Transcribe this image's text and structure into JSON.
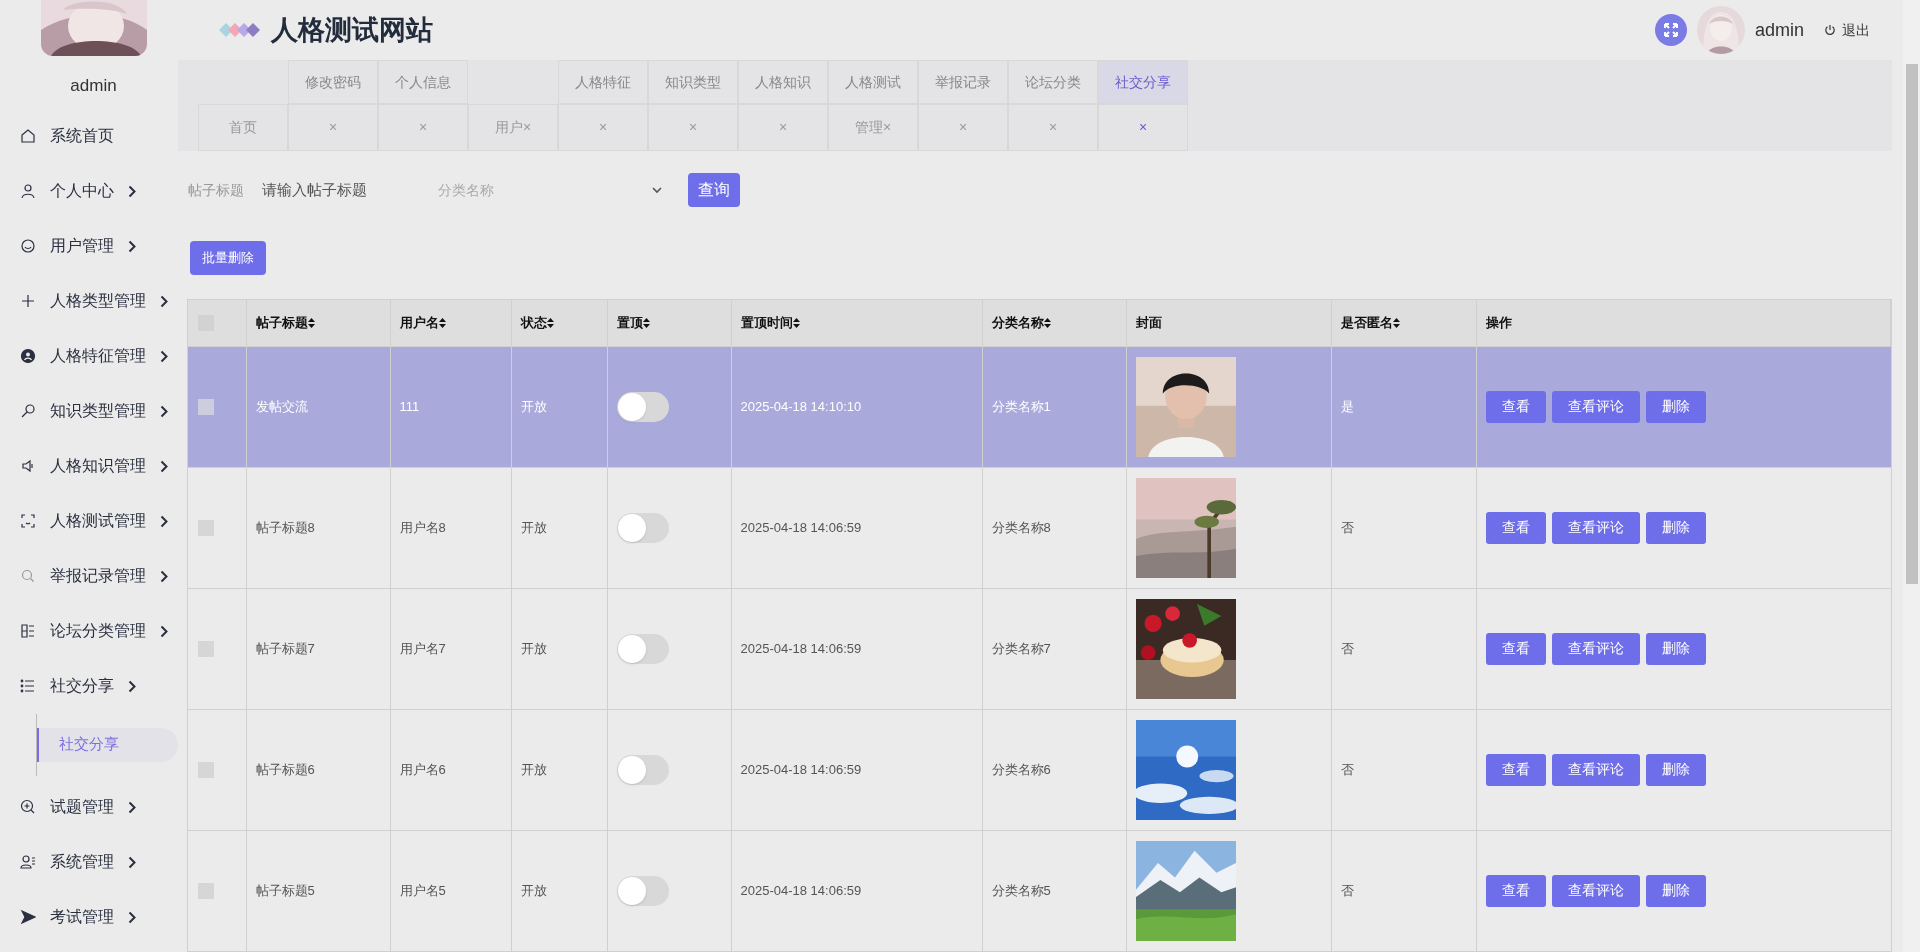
{
  "site_title": "人格测试网站",
  "sidebar": {
    "user": "admin",
    "menu": [
      {
        "label": "系统首页",
        "has_arrow": false
      },
      {
        "label": "个人中心",
        "has_arrow": true
      },
      {
        "label": "用户管理",
        "has_arrow": true
      },
      {
        "label": "人格类型管理",
        "has_arrow": true
      },
      {
        "label": "人格特征管理",
        "has_arrow": true
      },
      {
        "label": "知识类型管理",
        "has_arrow": true
      },
      {
        "label": "人格知识管理",
        "has_arrow": true
      },
      {
        "label": "人格测试管理",
        "has_arrow": true
      },
      {
        "label": "举报记录管理",
        "has_arrow": true
      },
      {
        "label": "论坛分类管理",
        "has_arrow": true
      },
      {
        "label": "社交分享",
        "has_arrow": true,
        "children": [
          {
            "label": "社交分享",
            "selected": true
          }
        ]
      },
      {
        "label": "试题管理",
        "has_arrow": true
      },
      {
        "label": "系统管理",
        "has_arrow": true
      },
      {
        "label": "考试管理",
        "has_arrow": true
      }
    ]
  },
  "header": {
    "user": "admin",
    "logout": "退出"
  },
  "tabs": [
    {
      "bottom": "首页",
      "selected": false
    },
    {
      "top": "修改密码",
      "bottom": "×",
      "selected": false
    },
    {
      "top": "个人信息",
      "bottom": "×",
      "selected": false
    },
    {
      "bottom": "用户×",
      "selected": false
    },
    {
      "top": "人格特征",
      "bottom": "×",
      "selected": false
    },
    {
      "top": "知识类型",
      "bottom": "×",
      "selected": false
    },
    {
      "top": "人格知识",
      "bottom": "×",
      "selected": false
    },
    {
      "top": "人格测试",
      "bottom": "管理×",
      "selected": false
    },
    {
      "top": "举报记录",
      "bottom": "×",
      "selected": false
    },
    {
      "top": "论坛分类",
      "bottom": "×",
      "selected": false
    },
    {
      "top": "社交分享",
      "bottom": "×",
      "selected": true
    }
  ],
  "search": {
    "label": "帖子标题",
    "placeholder": "请输入帖子标题",
    "category_placeholder": "分类名称",
    "button": "查询"
  },
  "batch_delete": "批量删除",
  "table": {
    "header_checked": false,
    "columns": [
      {
        "label": "帖子标题",
        "sortable": true
      },
      {
        "label": "用户名",
        "sortable": true
      },
      {
        "label": "状态",
        "sortable": true
      },
      {
        "label": "置顶",
        "sortable": true
      },
      {
        "label": "置顶时间",
        "sortable": true
      },
      {
        "label": "分类名称",
        "sortable": true
      },
      {
        "label": "封面",
        "sortable": false
      },
      {
        "label": "是否匿名",
        "sortable": true
      },
      {
        "label": "操作",
        "sortable": false
      }
    ],
    "rows": [
      {
        "selected": true,
        "checked": false,
        "title": "发帖交流",
        "user": "111",
        "status": "开放",
        "pinned": false,
        "pin_time": "2025-04-18 14:10:10",
        "category": "分类名称1",
        "anonymous": "是",
        "actions": [
          "查看",
          "查看评论",
          "删除"
        ]
      },
      {
        "selected": false,
        "checked": false,
        "title": "帖子标题8",
        "user": "用户名8",
        "status": "开放",
        "pinned": false,
        "pin_time": "2025-04-18 14:06:59",
        "category": "分类名称8",
        "anonymous": "否",
        "actions": [
          "查看",
          "查看评论",
          "删除"
        ]
      },
      {
        "selected": false,
        "checked": false,
        "title": "帖子标题7",
        "user": "用户名7",
        "status": "开放",
        "pinned": false,
        "pin_time": "2025-04-18 14:06:59",
        "category": "分类名称7",
        "anonymous": "否",
        "actions": [
          "查看",
          "查看评论",
          "删除"
        ]
      },
      {
        "selected": false,
        "checked": false,
        "title": "帖子标题6",
        "user": "用户名6",
        "status": "开放",
        "pinned": false,
        "pin_time": "2025-04-18 14:06:59",
        "category": "分类名称6",
        "anonymous": "否",
        "actions": [
          "查看",
          "查看评论",
          "删除"
        ]
      },
      {
        "selected": false,
        "checked": false,
        "title": "帖子标题5",
        "user": "用户名5",
        "status": "开放",
        "pinned": false,
        "pin_time": "2025-04-18 14:06:59",
        "category": "分类名称5",
        "anonymous": "否",
        "actions": [
          "查看",
          "查看评论",
          "删除"
        ]
      }
    ]
  }
}
